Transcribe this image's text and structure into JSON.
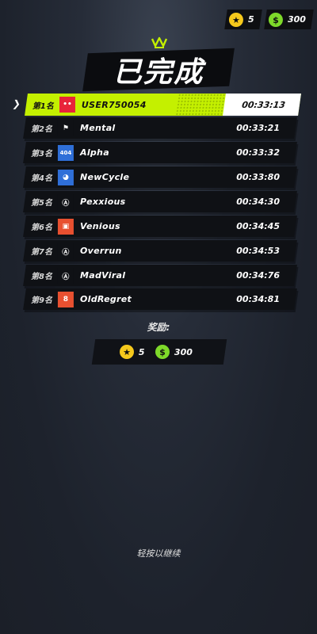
{
  "currency": {
    "stars": "5",
    "cash": "300",
    "star_icon": "star-coin-icon",
    "cash_icon": "cash-coin-icon"
  },
  "title": "已完成",
  "results": [
    {
      "rank": "第1名",
      "name": "USER750054",
      "time": "00:33:13",
      "avatar": "red-face-avatar",
      "avatar_color": "#e8243a",
      "highlight": true
    },
    {
      "rank": "第2名",
      "name": "Mental",
      "time": "00:33:21",
      "avatar": "checkered-flag-avatar",
      "avatar_color": "#0f1115"
    },
    {
      "rank": "第3名",
      "name": "Alpha",
      "time": "00:33:32",
      "avatar": "404-avatar",
      "avatar_color": "#2f6fd8"
    },
    {
      "rank": "第4名",
      "name": "NewCycle",
      "time": "00:33:80",
      "avatar": "duck-avatar",
      "avatar_color": "#2f6fd8"
    },
    {
      "rank": "第5名",
      "name": "Pexxious",
      "time": "00:34:30",
      "avatar": "anarchy-avatar",
      "avatar_color": "#0f1115"
    },
    {
      "rank": "第6名",
      "name": "Venious",
      "time": "00:34:45",
      "avatar": "card-avatar",
      "avatar_color": "#e85030"
    },
    {
      "rank": "第7名",
      "name": "Overrun",
      "time": "00:34:53",
      "avatar": "anarchy-avatar",
      "avatar_color": "#0f1115"
    },
    {
      "rank": "第8名",
      "name": "MadViral",
      "time": "00:34:76",
      "avatar": "anarchy-avatar",
      "avatar_color": "#0f1115"
    },
    {
      "rank": "第9名",
      "name": "OldRegret",
      "time": "00:34:81",
      "avatar": "eight-ball-avatar",
      "avatar_color": "#e85030"
    }
  ],
  "rewards": {
    "label": "奖励:",
    "stars": "5",
    "cash": "300"
  },
  "continue_hint": "轻按以继续",
  "colors": {
    "accent": "#c4f000",
    "star_coin": "#f6c91c",
    "cash_coin": "#7ed92a"
  }
}
